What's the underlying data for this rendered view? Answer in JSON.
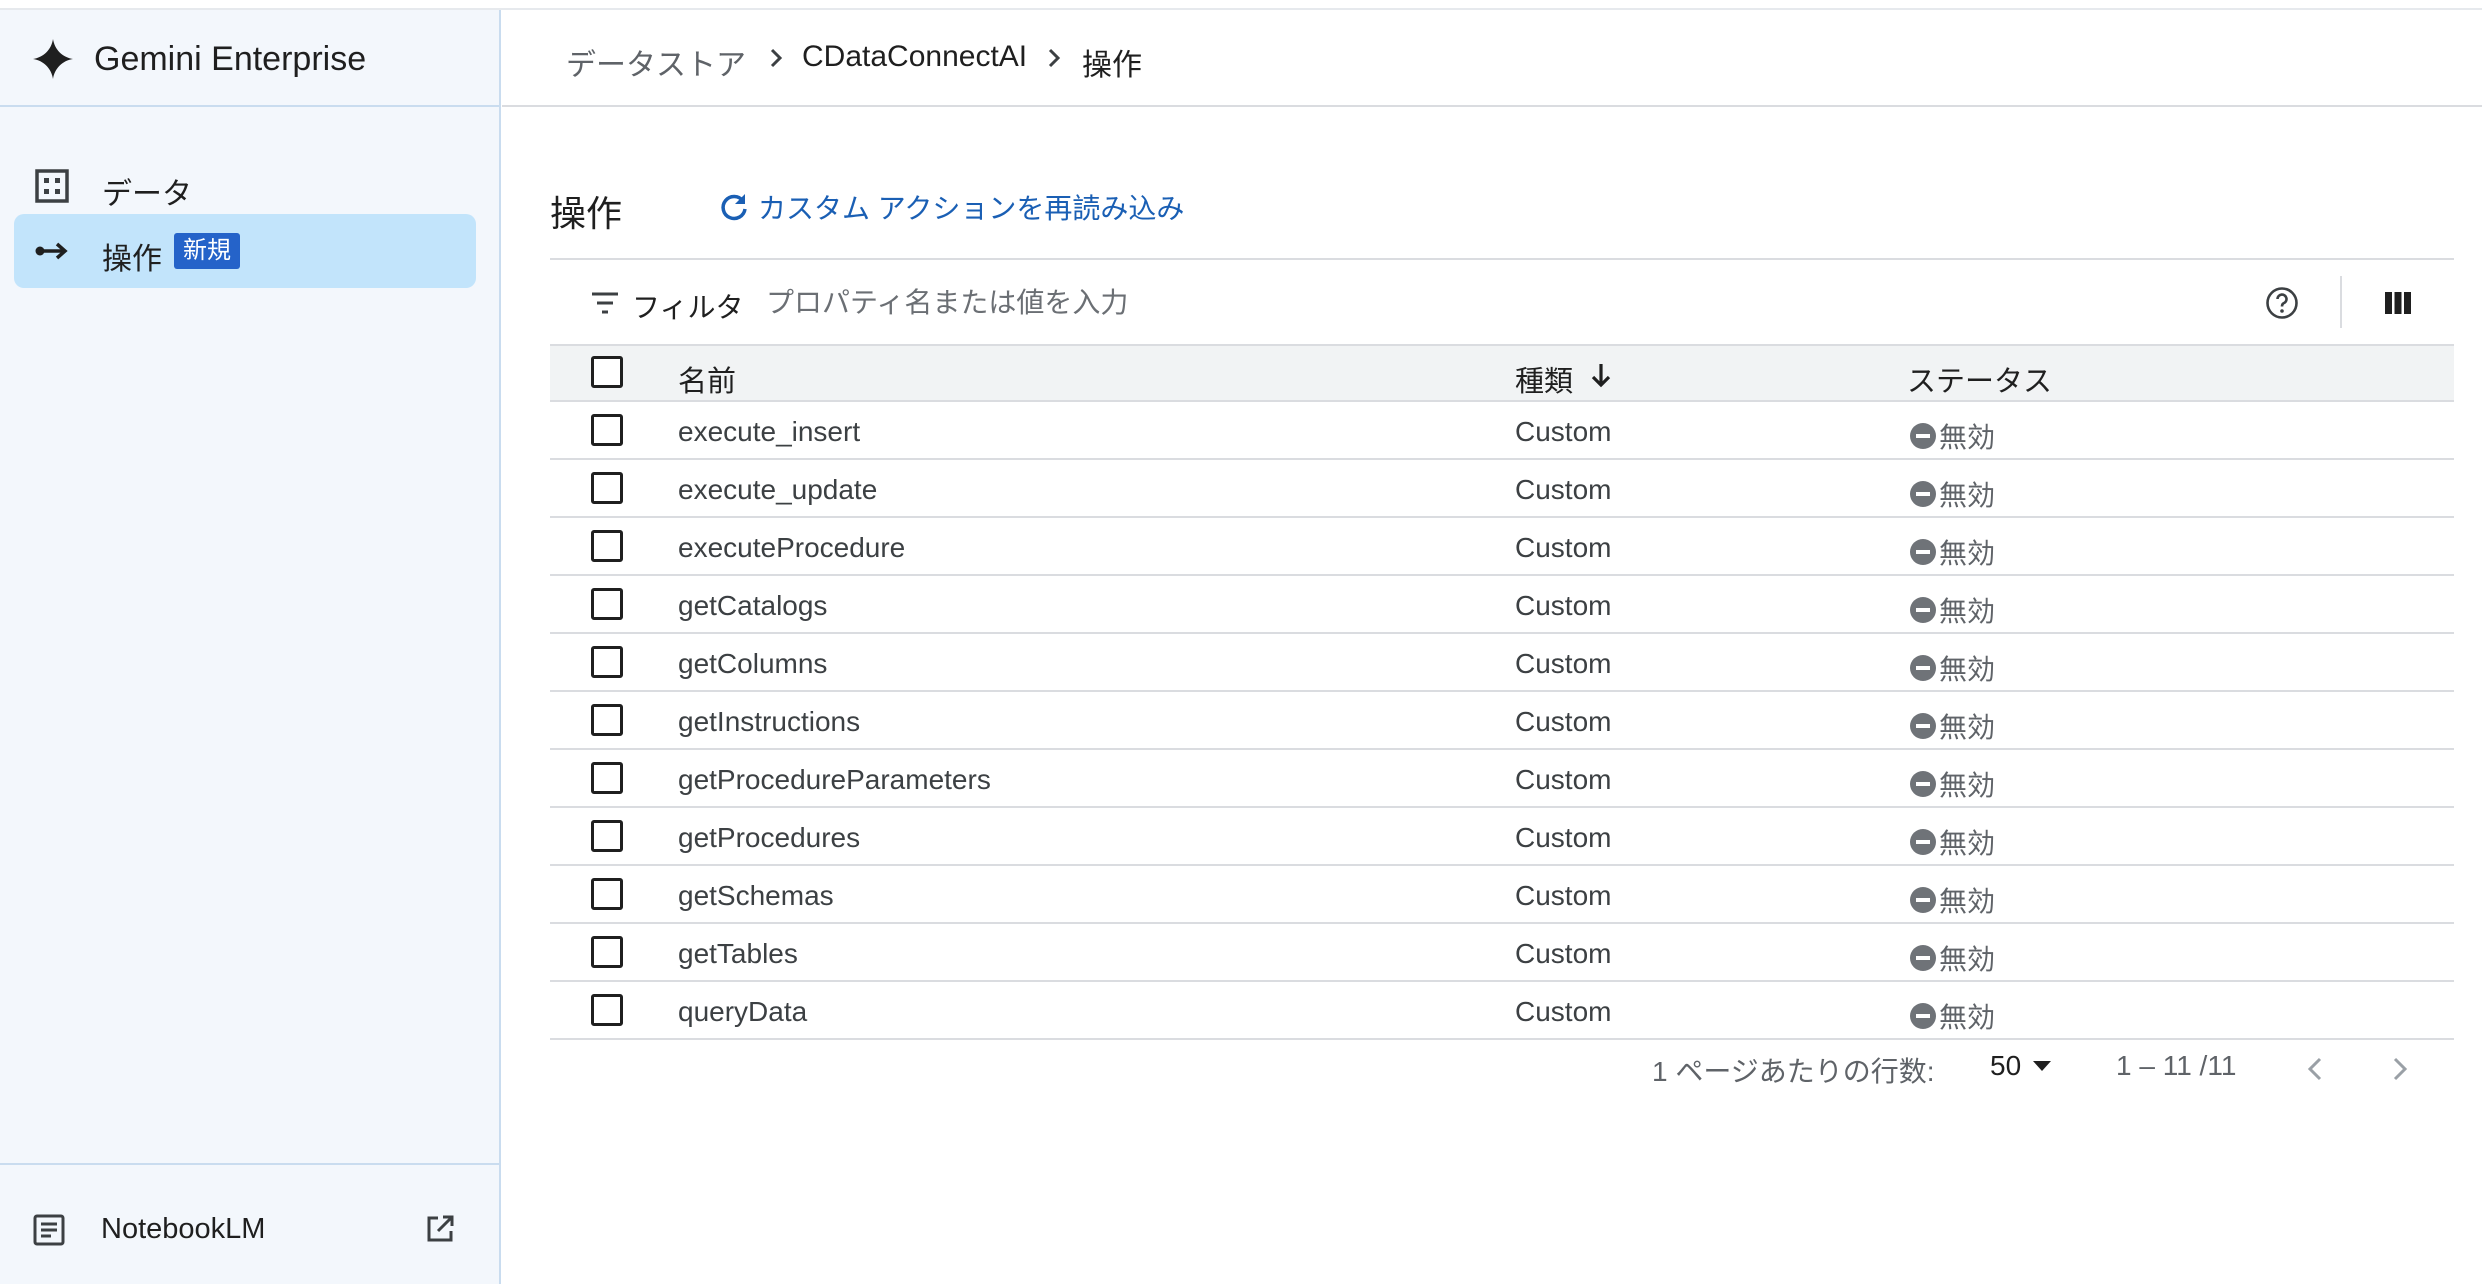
{
  "app": {
    "name": "Gemini Enterprise"
  },
  "sidebar": {
    "items": [
      {
        "label": "データ",
        "icon": "data-grid-icon",
        "active": false
      },
      {
        "label": "操作",
        "icon": "arrow-operations-icon",
        "active": true,
        "badge": "新規"
      }
    ],
    "footer": {
      "label": "NotebookLM",
      "icon": "notebook-icon",
      "external_icon": "open-in-new-icon"
    }
  },
  "breadcrumb": [
    "データストア",
    "CDataConnectAI",
    "操作"
  ],
  "page": {
    "title": "操作",
    "reload_label": "カスタム アクションを再読み込み"
  },
  "filter": {
    "label": "フィルタ",
    "placeholder": "プロパティ名または値を入力"
  },
  "table": {
    "columns": [
      "名前",
      "種類",
      "ステータス"
    ],
    "sorted_column": "種類",
    "sort_direction": "descending",
    "rows": [
      {
        "name": "execute_insert",
        "type": "Custom",
        "status": "無効"
      },
      {
        "name": "execute_update",
        "type": "Custom",
        "status": "無効"
      },
      {
        "name": "executeProcedure",
        "type": "Custom",
        "status": "無効"
      },
      {
        "name": "getCatalogs",
        "type": "Custom",
        "status": "無効"
      },
      {
        "name": "getColumns",
        "type": "Custom",
        "status": "無効"
      },
      {
        "name": "getInstructions",
        "type": "Custom",
        "status": "無効"
      },
      {
        "name": "getProcedureParameters",
        "type": "Custom",
        "status": "無効"
      },
      {
        "name": "getProcedures",
        "type": "Custom",
        "status": "無効"
      },
      {
        "name": "getSchemas",
        "type": "Custom",
        "status": "無効"
      },
      {
        "name": "getTables",
        "type": "Custom",
        "status": "無効"
      },
      {
        "name": "queryData",
        "type": "Custom",
        "status": "無効"
      }
    ]
  },
  "pagination": {
    "rows_per_page_label": "1 ページあたりの行数:",
    "rows_per_page": "50",
    "range": "1 – 11 /11"
  },
  "colors": {
    "sidebar_bg": "#f3f7fc",
    "active_nav_bg": "#c2e4fb",
    "badge_bg": "#2563c9",
    "link": "#1a5fb4",
    "status_disabled": "#6f7378"
  }
}
